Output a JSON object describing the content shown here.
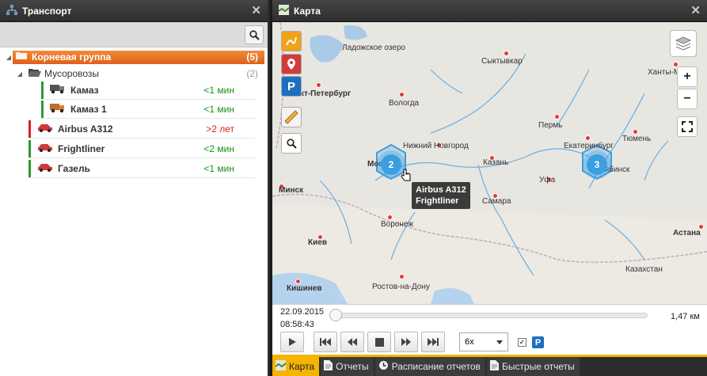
{
  "left_panel": {
    "title": "Транспорт",
    "tree": {
      "root": {
        "label": "Корневая группа",
        "count": "(5)"
      },
      "group": {
        "label": "Мусоровозы",
        "count": "(2)"
      },
      "vehicles": [
        {
          "name": "Камаз",
          "time": "<1 мин",
          "status": "green"
        },
        {
          "name": "Камаз 1",
          "time": "<1 мин",
          "status": "green"
        },
        {
          "name": "Airbus A312",
          "time": ">2 лет",
          "status": "red"
        },
        {
          "name": "Frightliner",
          "time": "<2 мин",
          "status": "green"
        },
        {
          "name": "Газель",
          "time": "<1 мин",
          "status": "green"
        }
      ]
    }
  },
  "map_panel": {
    "title": "Карта",
    "cities": [
      "Ладожское озеро",
      "Санкт-Петербург",
      "Сыктывкар",
      "Ханты-Манс",
      "Вологда",
      "Пермь",
      "Екатеринбург",
      "Тюмень",
      "Нижний Новгород",
      "Москва",
      "Казань",
      "Уфа",
      "Челябинск",
      "Минск",
      "Самара",
      "Воронеж",
      "Киев",
      "Астана",
      "Ростов-на-Дону",
      "Казахстан",
      "Кишинев"
    ],
    "clusters": [
      "2",
      "3"
    ],
    "tooltip": [
      "Airbus A312",
      "Frightliner"
    ],
    "zoom_in": "+",
    "zoom_out": "−"
  },
  "playback": {
    "date": "22.09.2015",
    "time": "08:58:43",
    "distance": "1,47 км",
    "speed": "6x",
    "checkbox_checked": true,
    "parking_badge": "P"
  },
  "tabs": [
    {
      "label": "Карта",
      "active": true
    },
    {
      "label": "Отчеты",
      "active": false
    },
    {
      "label": "Расписание отчетов",
      "active": false
    },
    {
      "label": "Быстрые отчеты",
      "active": false
    }
  ]
}
